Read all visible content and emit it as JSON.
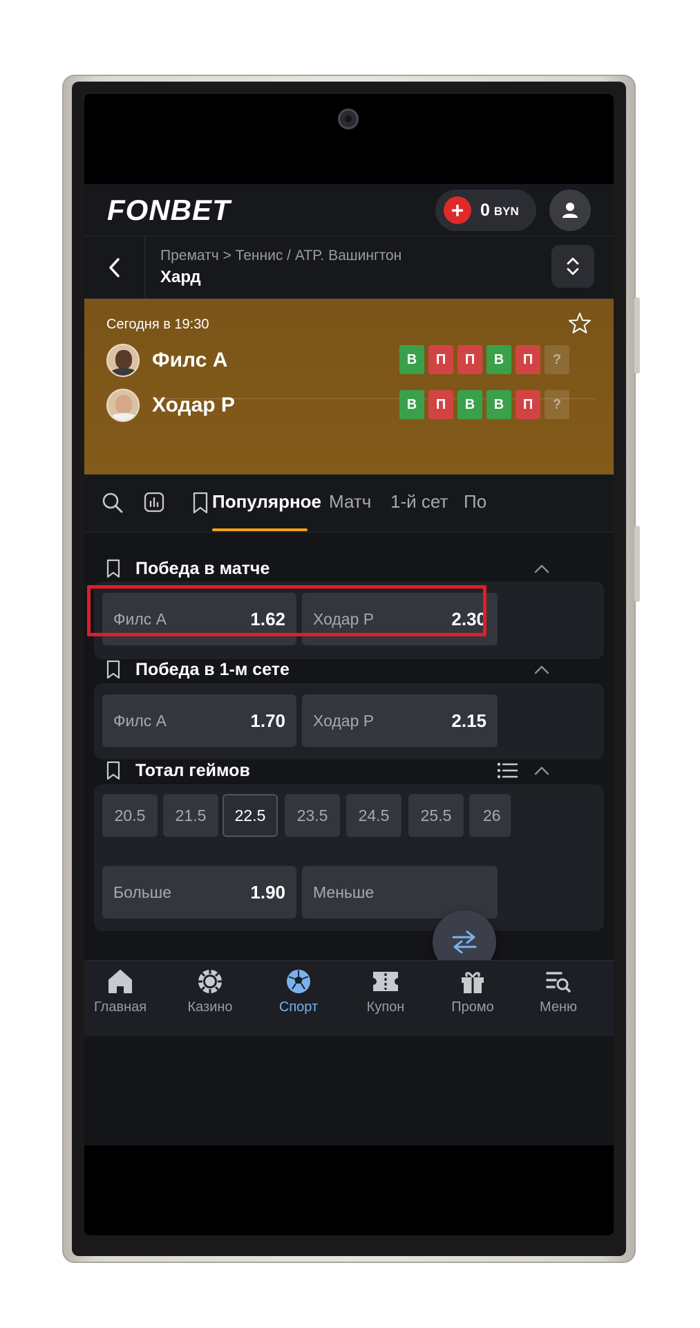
{
  "app": {
    "logo": "FONBET",
    "balance": {
      "amount": "0",
      "currency": "BYN"
    }
  },
  "breadcrumb": {
    "path": "Прематч > Теннис / ATP. Вашингтон",
    "title": "Хард"
  },
  "match": {
    "time": "Сегодня в 19:30",
    "players": [
      {
        "name": "Филс А",
        "form": [
          "В",
          "П",
          "П",
          "В",
          "П",
          "?"
        ]
      },
      {
        "name": "Ходар Р",
        "form": [
          "В",
          "П",
          "В",
          "В",
          "П",
          "?"
        ]
      }
    ]
  },
  "tabs": [
    "Популярное",
    "Матч",
    "1-й сет",
    "По"
  ],
  "markets": {
    "match_winner": {
      "title": "Победа в матче",
      "outcomes": [
        {
          "name": "Филс А",
          "odd": "1.62"
        },
        {
          "name": "Ходар Р",
          "odd": "2.30"
        }
      ]
    },
    "set1_winner": {
      "title": "Победа в 1-м сете",
      "outcomes": [
        {
          "name": "Филс А",
          "odd": "1.70"
        },
        {
          "name": "Ходар Р",
          "odd": "2.15"
        }
      ]
    },
    "total_games": {
      "title": "Тотал геймов",
      "lines": [
        "20.5",
        "21.5",
        "22.5",
        "23.5",
        "24.5",
        "25.5",
        "26"
      ],
      "selected_line": "22.5",
      "outcomes": [
        {
          "name": "Больше",
          "odd": "1.90"
        },
        {
          "name": "Меньше",
          "odd": ""
        }
      ]
    }
  },
  "nav": [
    "Главная",
    "Казино",
    "Спорт",
    "Купон",
    "Промо",
    "Меню"
  ],
  "nav_active": "Спорт",
  "colors": {
    "accent_underline": "#f3a41a",
    "win": "#3aa14a",
    "loss": "#d24444",
    "highlight_border": "#e11d2a",
    "nav_active": "#7ab2f0"
  }
}
